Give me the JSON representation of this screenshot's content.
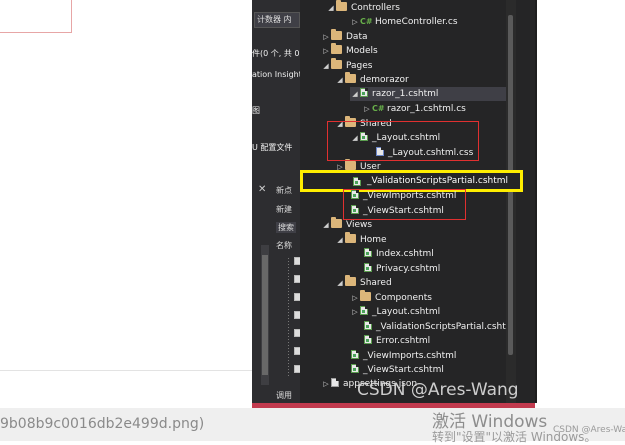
{
  "left": {
    "filename_tail": "9b08b9c0016db2e499d.png)"
  },
  "mid": {
    "tab_label": "计数器",
    "tab_extra": "内",
    "label_count": "件(0 个, 共 0",
    "label_insights": "ation Insight",
    "label_tu": "图",
    "label_config": "U 配置文件",
    "close_glyph": "✕",
    "panel_new_point": "新点",
    "panel_new": "新建",
    "panel_search": "搜索",
    "panel_name": "名称",
    "panel_call": "调用"
  },
  "tree": {
    "items": [
      {
        "label": "Controllers"
      },
      {
        "label": "HomeController.cs",
        "prefix": "C#"
      },
      {
        "label": "Data"
      },
      {
        "label": "Models"
      },
      {
        "label": "Pages"
      },
      {
        "label": "demorazor"
      },
      {
        "label": "razor_1.cshtml"
      },
      {
        "label": "razor_1.cshtml.cs",
        "prefix": "C#"
      },
      {
        "label": "Shared"
      },
      {
        "label": "_Layout.cshtml"
      },
      {
        "label": "_Layout.cshtml.css"
      },
      {
        "label": "User"
      },
      {
        "label": "_ValidationScriptsPartial.cshtml"
      },
      {
        "label": "_ViewImports.cshtml"
      },
      {
        "label": "_ViewStart.cshtml"
      },
      {
        "label": "Views"
      },
      {
        "label": "Home"
      },
      {
        "label": "Index.cshtml"
      },
      {
        "label": "Privacy.cshtml"
      },
      {
        "label": "Shared"
      },
      {
        "label": "Components"
      },
      {
        "label": "_Layout.cshtml"
      },
      {
        "label": "_ValidationScriptsPartial.cshtml"
      },
      {
        "label": "Error.cshtml"
      },
      {
        "label": "_ViewImports.cshtml"
      },
      {
        "label": "_ViewStart.cshtml"
      },
      {
        "label": "appsettings.json"
      }
    ]
  },
  "watermark": {
    "csdn": "CSDN @Ares-Wang",
    "csdn_small": "CSDN @Ares-Wang",
    "win_line1": "激活 Windows",
    "win_line2": "转到\"设置\"以激活 Windows。"
  },
  "colors": {
    "vs_background": "#252526",
    "highlight_yellow": "#ffee00",
    "highlight_red": "#e03030",
    "csharp_green": "#68b04a",
    "folder": "#dcb67a"
  }
}
